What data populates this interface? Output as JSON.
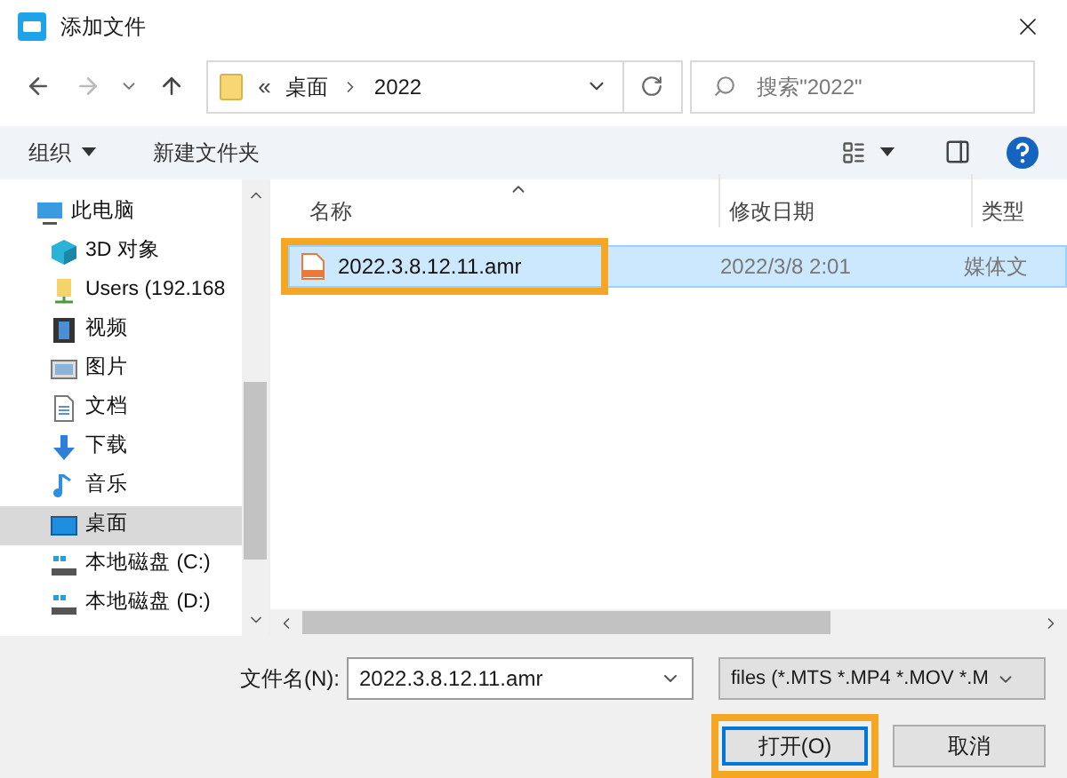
{
  "window": {
    "title": "添加文件"
  },
  "address": {
    "path": [
      {
        "label": "桌面"
      },
      {
        "label": "2022"
      }
    ],
    "overflow": "«"
  },
  "search": {
    "placeholder": "搜索\"2022\""
  },
  "toolbar": {
    "organize": "组织",
    "new_folder": "新建文件夹"
  },
  "sidebar": {
    "items": [
      {
        "label": "此电脑",
        "kind": "pc",
        "selected": false,
        "children": [
          {
            "label": "3D 对象",
            "kind": "cube",
            "selected": false
          },
          {
            "label": "Users (192.168",
            "kind": "network",
            "selected": false
          },
          {
            "label": "视频",
            "kind": "video",
            "selected": false
          },
          {
            "label": "图片",
            "kind": "picture",
            "selected": false
          },
          {
            "label": "文档",
            "kind": "doc",
            "selected": false
          },
          {
            "label": "下载",
            "kind": "download",
            "selected": false
          },
          {
            "label": "音乐",
            "kind": "music",
            "selected": false
          },
          {
            "label": "桌面",
            "kind": "desktop",
            "selected": true
          },
          {
            "label": "本地磁盘 (C:)",
            "kind": "drive",
            "selected": false
          },
          {
            "label": "本地磁盘 (D:)",
            "kind": "drive",
            "selected": false
          }
        ]
      }
    ]
  },
  "table": {
    "columns": [
      "名称",
      "修改日期",
      "类型"
    ],
    "rows": [
      {
        "name": "2022.3.8.12.11.amr",
        "date": "2022/3/8 2:01",
        "type": "媒体文",
        "selected": true,
        "highlighted": true
      }
    ]
  },
  "footer": {
    "filename_label": "文件名(N):",
    "filename": "2022.3.8.12.11.amr",
    "filetype": "files (*.MTS *.MP4 *.MOV *.M",
    "open": {
      "label": "打开(O)",
      "highlighted": true
    },
    "cancel": "取消"
  }
}
